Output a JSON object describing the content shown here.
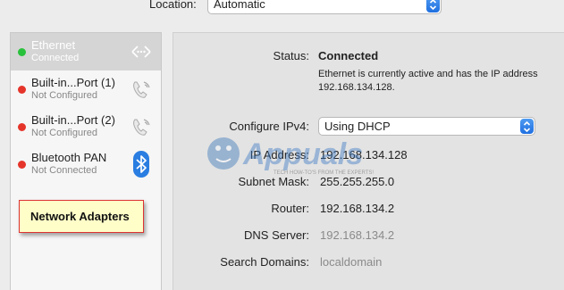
{
  "location": {
    "label": "Location:",
    "value": "Automatic"
  },
  "sidebar": {
    "items": [
      {
        "name": "Ethernet",
        "status": "Connected",
        "state": "green",
        "icon": "ethernet-arrows-icon",
        "selected": true
      },
      {
        "name": "Built-in...Port (1)",
        "status": "Not Configured",
        "state": "red",
        "icon": "phone-icon",
        "selected": false
      },
      {
        "name": "Built-in...Port (2)",
        "status": "Not Configured",
        "state": "red",
        "icon": "phone-icon",
        "selected": false
      },
      {
        "name": "Bluetooth PAN",
        "status": "Not Connected",
        "state": "red",
        "icon": "bluetooth-icon",
        "selected": false
      }
    ]
  },
  "callout": {
    "label": "Network Adapters"
  },
  "details": {
    "status_label": "Status:",
    "status_value": "Connected",
    "status_desc": "Ethernet is currently active and has the IP address 192.168.134.128.",
    "configure_label": "Configure IPv4:",
    "configure_value": "Using DHCP",
    "ip_label": "IP Address:",
    "ip_value": "192.168.134.128",
    "subnet_label": "Subnet Mask:",
    "subnet_value": "255.255.255.0",
    "router_label": "Router:",
    "router_value": "192.168.134.2",
    "dns_label": "DNS Server:",
    "dns_value": "192.168.134.2",
    "search_label": "Search Domains:",
    "search_value": "localdomain"
  },
  "watermark": {
    "brand": "Appuals",
    "tagline": "TECH HOW-TO'S FROM THE EXPERTS!"
  },
  "colors": {
    "connected": "#28c13b",
    "disconnected": "#e5352b",
    "accent": "#1f6fe0",
    "callout_border": "#dd3333"
  }
}
